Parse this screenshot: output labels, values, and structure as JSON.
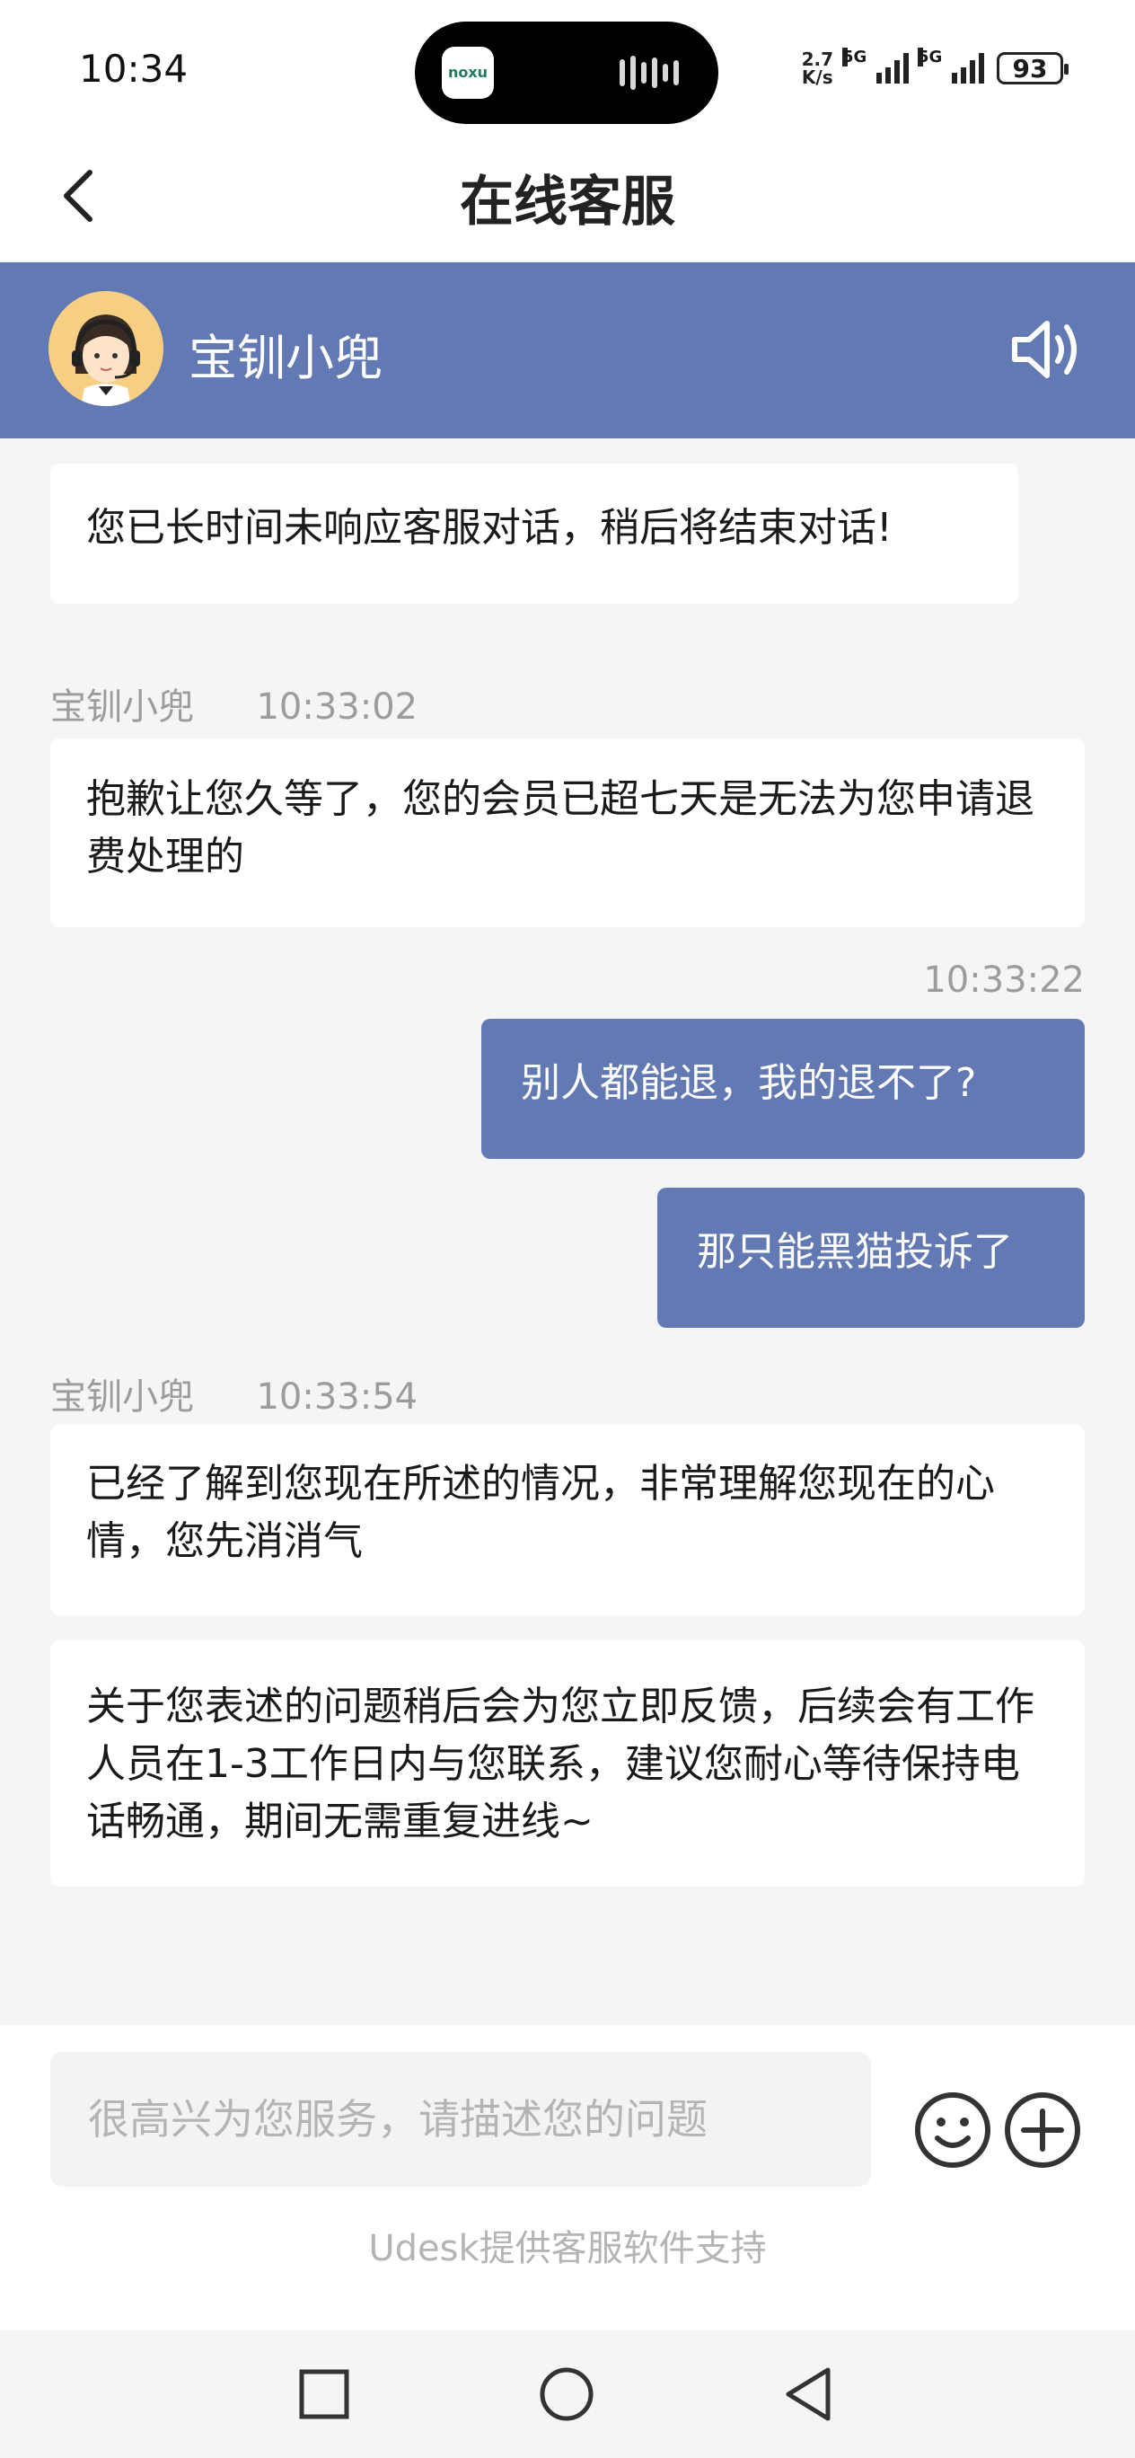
{
  "status_bar": {
    "time": "10:34",
    "island_app": "noxu",
    "net_speed_value": "2.7",
    "net_speed_unit": "K/s",
    "signal1_label": "5G",
    "signal2_label": "5G",
    "battery": "93"
  },
  "header": {
    "title": "在线客服"
  },
  "agent": {
    "name": "宝钏小兜"
  },
  "messages": {
    "m1": {
      "text": "您已长时间未响应客服对话，稍后将结束对话!"
    },
    "m2": {
      "sender": "宝钏小兜",
      "time": "10:33:02",
      "text": "抱歉让您久等了，您的会员已超七天是无法为您申请退费处理的"
    },
    "m3": {
      "time": "10:33:22",
      "text": "别人都能退，我的退不了?"
    },
    "m4": {
      "text": "那只能黑猫投诉了"
    },
    "m5": {
      "sender": "宝钏小兜",
      "time": "10:33:54",
      "text": "已经了解到您现在所述的情况，非常理解您现在的心情，您先消消气"
    },
    "m6": {
      "text": "关于您表述的问题稍后会为您立即反馈，后续会有工作人员在1-3工作日内与您联系，建议您耐心等待保持电话畅通，期间无需重复进线~"
    }
  },
  "input": {
    "placeholder": "很高兴为您服务，请描述您的问题"
  },
  "footer": {
    "powered_by": "Udesk提供客服软件支持"
  },
  "colors": {
    "accent": "#6379b3",
    "background": "#f5f5f7",
    "bubble": "#ffffff",
    "meta_text": "#9c9c9c"
  },
  "icons": {
    "back": "chevron-left-icon",
    "speaker": "speaker-icon",
    "emoji": "smiley-icon",
    "plus": "plus-circle-icon",
    "nav_recent": "square-icon",
    "nav_home": "circle-icon",
    "nav_back": "triangle-back-icon"
  }
}
